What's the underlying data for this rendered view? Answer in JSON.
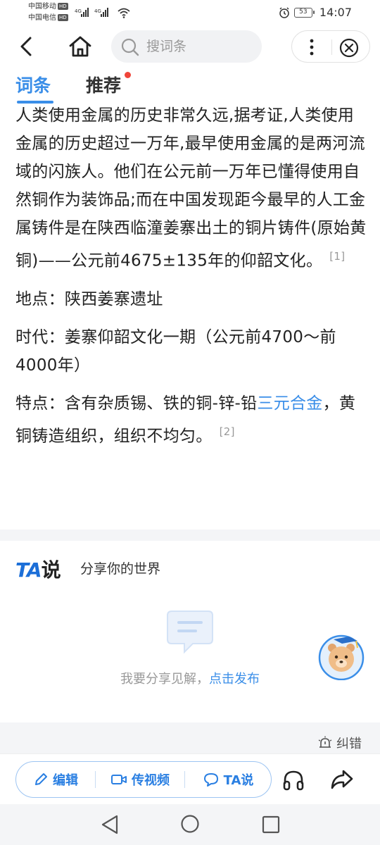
{
  "status_bar": {
    "carrier1": "中国移动",
    "carrier2": "中国电信",
    "hd": "HD",
    "battery": "53",
    "time": "14:07"
  },
  "nav": {
    "search_placeholder": "搜词条"
  },
  "tabs": [
    {
      "label": "词条",
      "active": true
    },
    {
      "label": "推荐",
      "active": false,
      "has_dot": true
    }
  ],
  "article": {
    "para1": "人类使用金属的历史非常久远,据考证,人类使用金属的历史超过一万年,最早使用金属的是两河流域的闪族人。他们在公元前一万年已懂得使用自然铜作为装饰品;而在中国发现距今最早的人工金属铸件是在陕西临潼姜寨出土的铜片铸件(原始黄铜)——公元前4675±135年的仰韶文化。",
    "cite1": "[1]",
    "para2": "地点：陕西姜寨遗址",
    "para3": "时代：姜寨仰韶文化一期（公元前4700～前4000年）",
    "para4_a": "特点：含有杂质锡、铁的铜-锌-铅",
    "para4_link": "三元合金",
    "para4_b": "，黄铜铸造组织，组织不均匀。",
    "cite2": "[2]"
  },
  "ta": {
    "logo_ta": "TA",
    "logo_shuo": "说",
    "slogan": "分享你的世界",
    "empty_text": "我要分享见解，",
    "empty_link": "点击发布"
  },
  "report_label": "纠错",
  "actions": {
    "edit": "编辑",
    "video": "传视频",
    "ta": "TA说"
  },
  "colors": {
    "accent": "#3a8ee8",
    "dot": "#f0453a"
  }
}
